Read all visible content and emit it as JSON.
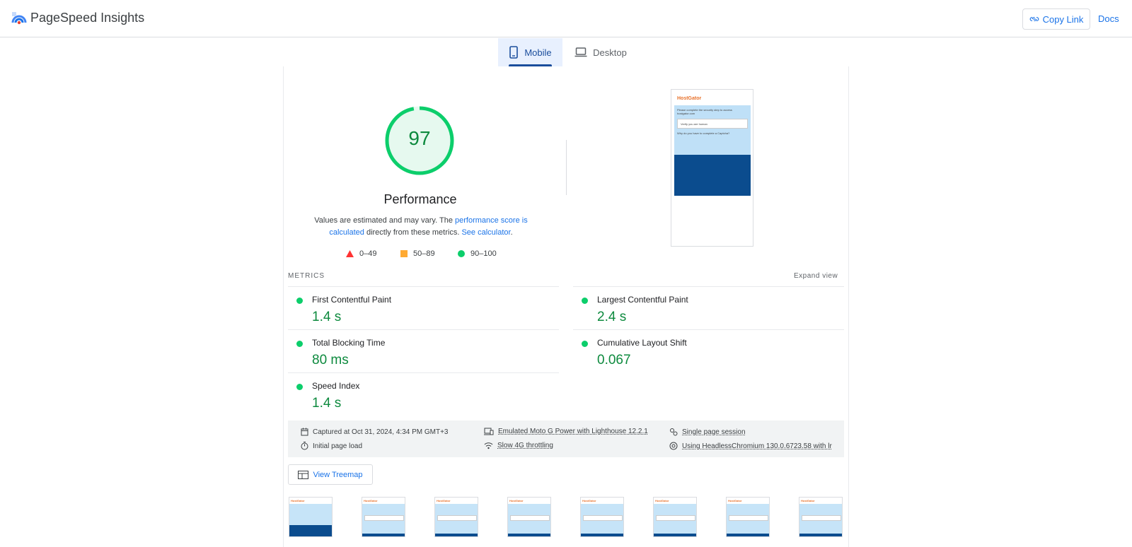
{
  "header": {
    "brand": "PageSpeed Insights",
    "copy_link": "Copy Link",
    "docs": "Docs"
  },
  "tabs": [
    {
      "label": "Mobile",
      "active": true
    },
    {
      "label": "Desktop",
      "active": false
    }
  ],
  "performance": {
    "score": "97",
    "score_fraction": 0.97,
    "title": "Performance",
    "desc_prefix": "Values are estimated and may vary. The ",
    "desc_link1": "performance score is calculated",
    "desc_middle": " directly from these metrics. ",
    "desc_link2": "See calculator",
    "desc_suffix": "."
  },
  "legend": [
    {
      "range": "0–49",
      "shape": "triangle",
      "color": "#ff3333"
    },
    {
      "range": "50–89",
      "shape": "square",
      "color": "#ffaa33"
    },
    {
      "range": "90–100",
      "shape": "circle",
      "color": "#0cce6b"
    }
  ],
  "screenshot": {
    "site_name": "HostGator",
    "text1": "Please complete the security step to access hostgator.com",
    "checkbox": "Verify you are human",
    "text2": "Why do you have to complete a Captcha?"
  },
  "metrics": {
    "label": "METRICS",
    "expand": "Expand view",
    "items": [
      {
        "name": "First Contentful Paint",
        "value": "1.4 s"
      },
      {
        "name": "Largest Contentful Paint",
        "value": "2.4 s"
      },
      {
        "name": "Total Blocking Time",
        "value": "80 ms"
      },
      {
        "name": "Cumulative Layout Shift",
        "value": "0.067"
      },
      {
        "name": "Speed Index",
        "value": "1.4 s"
      }
    ]
  },
  "info": {
    "captured": "Captured at Oct 31, 2024, 4:34 PM GMT+3",
    "device": "Emulated Moto G Power with Lighthouse 12.2.1",
    "session": "Single page session",
    "load": "Initial page load",
    "throttling": "Slow 4G throttling",
    "browser": "Using HeadlessChromium 130.0.6723.58 with lr"
  },
  "treemap": "View Treemap",
  "thumbnails": {
    "site_name": "HostGator"
  },
  "colors": {
    "pass": "#0cce6b",
    "pass_text": "#0d8a3e",
    "link": "#1a73e8",
    "tab_active_bg": "#e8f0fe"
  }
}
